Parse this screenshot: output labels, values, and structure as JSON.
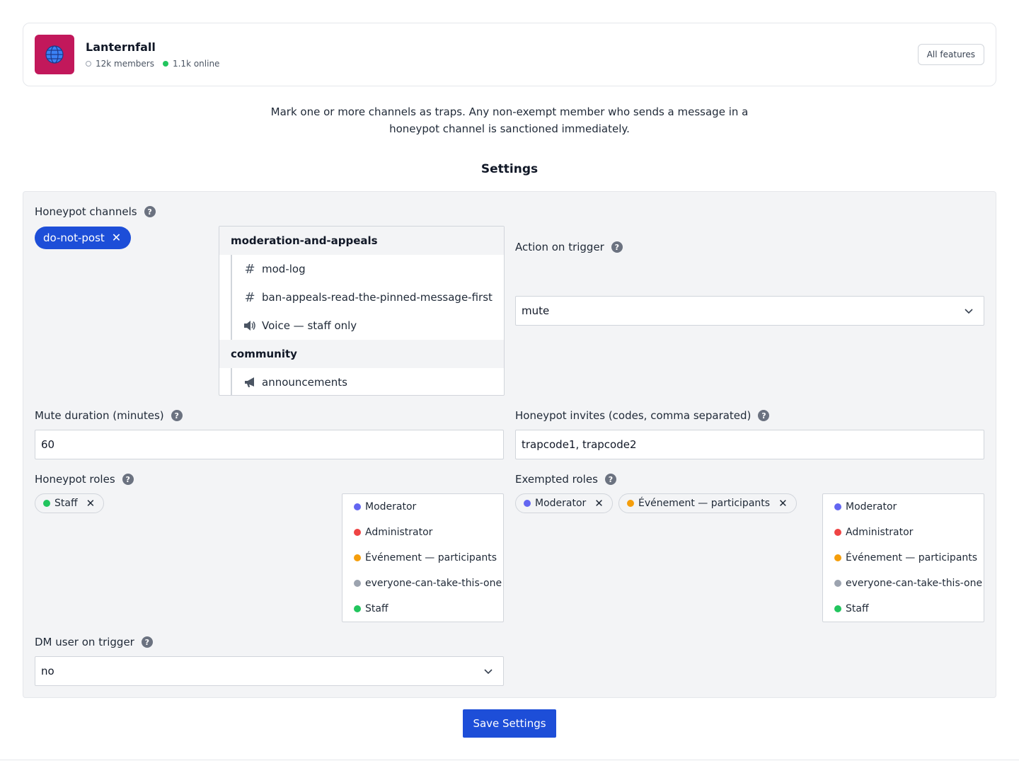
{
  "server": {
    "name": "Lanternfall",
    "members": "12k members",
    "online": "1.1k online",
    "icon": "globe-icon",
    "icon_color": "#c2185b",
    "all_features_label": "All features"
  },
  "description": "Mark one or more channels as traps. Any non-exempt member who sends a message in a honeypot channel is sanctioned immediately.",
  "settings_heading": "Settings",
  "honeypot_channels": {
    "label": "Honeypot channels",
    "selected": [
      "do-not-post"
    ],
    "dropdown": [
      {
        "category": "moderation-and-appeals",
        "channels": [
          {
            "name": "mod-log",
            "icon": "hash-icon"
          },
          {
            "name": "ban-appeals-read-the-pinned-message-first",
            "icon": "hash-icon"
          },
          {
            "name": "Voice — staff only",
            "icon": "speaker-icon"
          }
        ]
      },
      {
        "category": "community",
        "channels": [
          {
            "name": "announcements",
            "icon": "megaphone-icon"
          }
        ]
      }
    ]
  },
  "action_on_trigger": {
    "label": "Action on trigger",
    "value": "mute"
  },
  "mute_duration": {
    "label": "Mute duration (minutes)",
    "value": "60"
  },
  "honeypot_invites": {
    "label": "Honeypot invites (codes, comma separated)",
    "value": "trapcode1, trapcode2"
  },
  "honeypot_roles": {
    "label": "Honeypot roles",
    "selected": [
      {
        "name": "Staff",
        "color": "#22c55e"
      }
    ]
  },
  "exempted_roles": {
    "label": "Exempted roles",
    "selected": [
      {
        "name": "Moderator",
        "color": "#6366f1"
      },
      {
        "name": "Événement — participants",
        "color": "#f59e0b"
      }
    ]
  },
  "role_options": [
    {
      "name": "Moderator",
      "color": "#6366f1"
    },
    {
      "name": "Administrator",
      "color": "#ef4444"
    },
    {
      "name": "Événement — participants",
      "color": "#f59e0b"
    },
    {
      "name": "everyone-can-take-this-one",
      "color": "#9ca3af"
    },
    {
      "name": "Staff",
      "color": "#22c55e"
    }
  ],
  "dm_user": {
    "label": "DM user on trigger",
    "value": "no"
  },
  "save_label": "Save Settings",
  "colors": {
    "primary": "#1d4ed8",
    "online": "#22c55e",
    "panel_bg": "#f3f4f6"
  }
}
